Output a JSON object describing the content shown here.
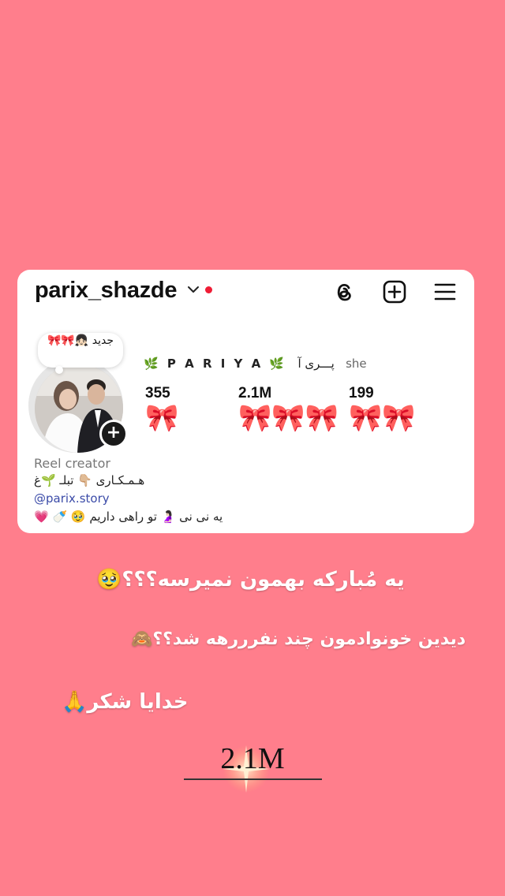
{
  "profile": {
    "username": "parix_shazde",
    "note": "جدید 👧🏻🎀🎀",
    "display_name_brand": "🌿 P A R I Y A 🌿",
    "display_name_fa": "پـــری آ",
    "pronouns": "she",
    "stats": [
      {
        "value": "355",
        "decoration": "🎀"
      },
      {
        "value": "2.1M",
        "decoration": "🎀🎀🎀"
      },
      {
        "value": "199",
        "decoration": "🎀🎀"
      }
    ],
    "category": "Reel creator",
    "bio_line1": "هـمـکـاری 👇🏼 تبلـ 🌱غ",
    "link": "@parix.story",
    "bio_line2": "یه نی نی 🤰🏻 تو راهی داریم 🥹 🍼 💗"
  },
  "icons": {
    "threads": "threads-icon",
    "create": "plus-square-icon",
    "menu": "hamburger-menu-icon",
    "dropdown": "chevron-down-icon",
    "status": "red-dot-icon",
    "add_story": "plus-circle-icon"
  },
  "story_text": {
    "line1": "یه مُبارکه بهمون نمیرسه؟؟؟🥹",
    "line2": "دیدین خونوادمون چند نفرررهه شد؟؟🙈",
    "line3": "خدایا شکر🙏",
    "big_stat": "2.1M"
  },
  "colors": {
    "background": "#ff7e8c",
    "card": "#ffffff",
    "link": "#3b4ba8",
    "status_dot": "#ef1c35"
  }
}
